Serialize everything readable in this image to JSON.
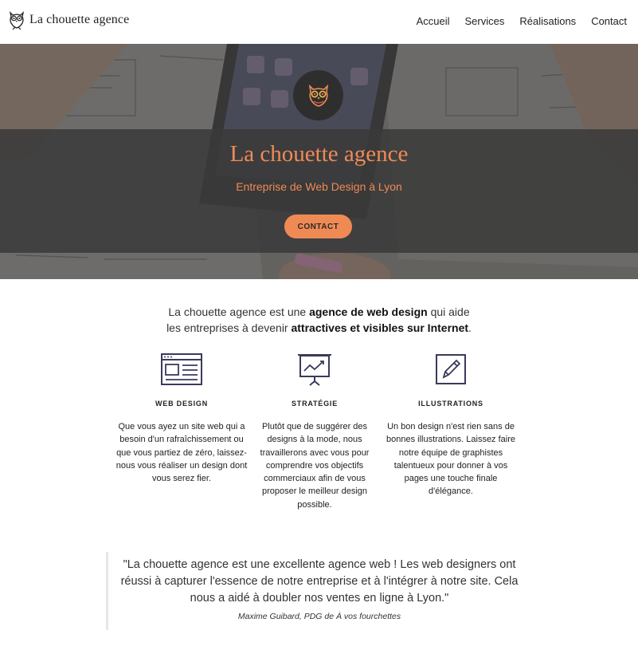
{
  "header": {
    "logo_text": "La chouette agence",
    "nav": [
      "Accueil",
      "Services",
      "Réalisations",
      "Contact"
    ]
  },
  "hero": {
    "title": "La chouette agence",
    "subtitle": "Entreprise de Web Design à Lyon",
    "button": "CONTACT"
  },
  "intro": {
    "p1": "La chouette agence est une ",
    "b1": "agence de web design",
    "p2": " qui aide",
    "p3": "les entreprises à devenir ",
    "b2": "attractives et visibles sur Internet",
    "p4": "."
  },
  "services": [
    {
      "icon": "browser-window-icon",
      "title": "WEB DESIGN",
      "text": "Que vous ayez un site web qui a besoin d'un rafraîchissement ou que vous partiez de zéro, laissez-nous vous réaliser un design dont vous serez fier."
    },
    {
      "icon": "presentation-chart-icon",
      "title": "STRATÉGIE",
      "text": "Plutôt que de suggérer des designs à la mode, nous travaillerons avec vous pour comprendre vos objectifs commerciaux afin de vous proposer le meilleur design possible."
    },
    {
      "icon": "pencil-edit-icon",
      "title": "ILLUSTRATIONS",
      "text": "Un bon design n'est rien sans de bonnes illustrations. Laissez faire notre équipe de graphistes talentueux pour donner à vos pages une touche finale d'élégance."
    }
  ],
  "testimonial": {
    "quote": "\"La chouette agence est une excellente agence web ! Les web designers ont réussi à capturer l'essence de notre entreprise et à l'intégrer à notre site. Cela nous a aidé à doubler nos ventes en ligne à Lyon.\"",
    "author": "Maxime Guibard, PDG de À vos fourchettes"
  },
  "colors": {
    "accent": "#f08a55",
    "band": "#3a3a3a",
    "icon": "#3b3a5c"
  }
}
